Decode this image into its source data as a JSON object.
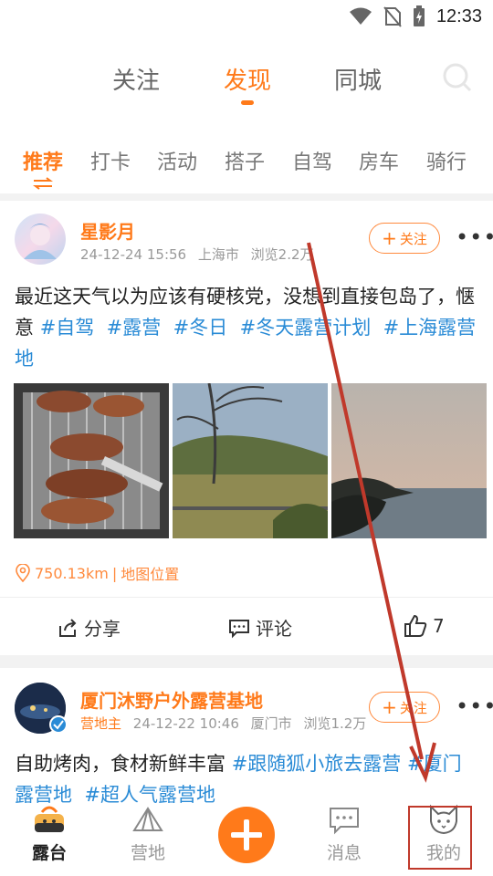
{
  "status_bar": {
    "time": "12:33",
    "icons": [
      "wifi-icon",
      "no-sim-icon",
      "battery-charging-icon"
    ]
  },
  "top_nav": {
    "tabs": [
      {
        "label": "关注",
        "active": false
      },
      {
        "label": "发现",
        "active": true
      },
      {
        "label": "同城",
        "active": false
      }
    ],
    "search_icon": "search-icon"
  },
  "sub_tabs": [
    {
      "label": "推荐",
      "active": true
    },
    {
      "label": "打卡",
      "active": false
    },
    {
      "label": "活动",
      "active": false
    },
    {
      "label": "搭子",
      "active": false
    },
    {
      "label": "自驾",
      "active": false
    },
    {
      "label": "房车",
      "active": false
    },
    {
      "label": "骑行",
      "active": false
    }
  ],
  "posts": [
    {
      "username": "星影月",
      "date": "24-12-24 15:56",
      "city": "上海市",
      "views": "浏览2.2万",
      "follow_label": "关注",
      "text": "最近这天气以为应该有硬核党，没想到直接包岛了，惬意",
      "tags": [
        "#自驾",
        "#露营",
        "#冬日",
        "#冬天露营计划",
        "#上海露营地"
      ],
      "distance": "750.13km",
      "map_link": "地图位置",
      "share_label": "分享",
      "comment_label": "评论",
      "like_count": "7"
    },
    {
      "username": "厦门沐野户外露营基地",
      "badge": "营地主",
      "date": "24-12-22 10:46",
      "city": "厦门市",
      "views": "浏览1.2万",
      "follow_label": "关注",
      "text": "自助烤肉，食材新鲜丰富",
      "tags": [
        "#跟随狐小旅去露营",
        "#厦门露营地",
        "#超人气露营地"
      ]
    }
  ],
  "bottom_nav": [
    {
      "label": "露台",
      "active": true,
      "icon": "terrace-icon"
    },
    {
      "label": "营地",
      "active": false,
      "icon": "tent-icon"
    },
    {
      "label": "",
      "active": false,
      "icon": "plus-icon"
    },
    {
      "label": "消息",
      "active": false,
      "icon": "message-icon"
    },
    {
      "label": "我的",
      "active": false,
      "icon": "fox-face-icon"
    }
  ],
  "colors": {
    "accent": "#ff7a1a",
    "tag": "#2a8bd6",
    "annotation": "#c0392b"
  }
}
